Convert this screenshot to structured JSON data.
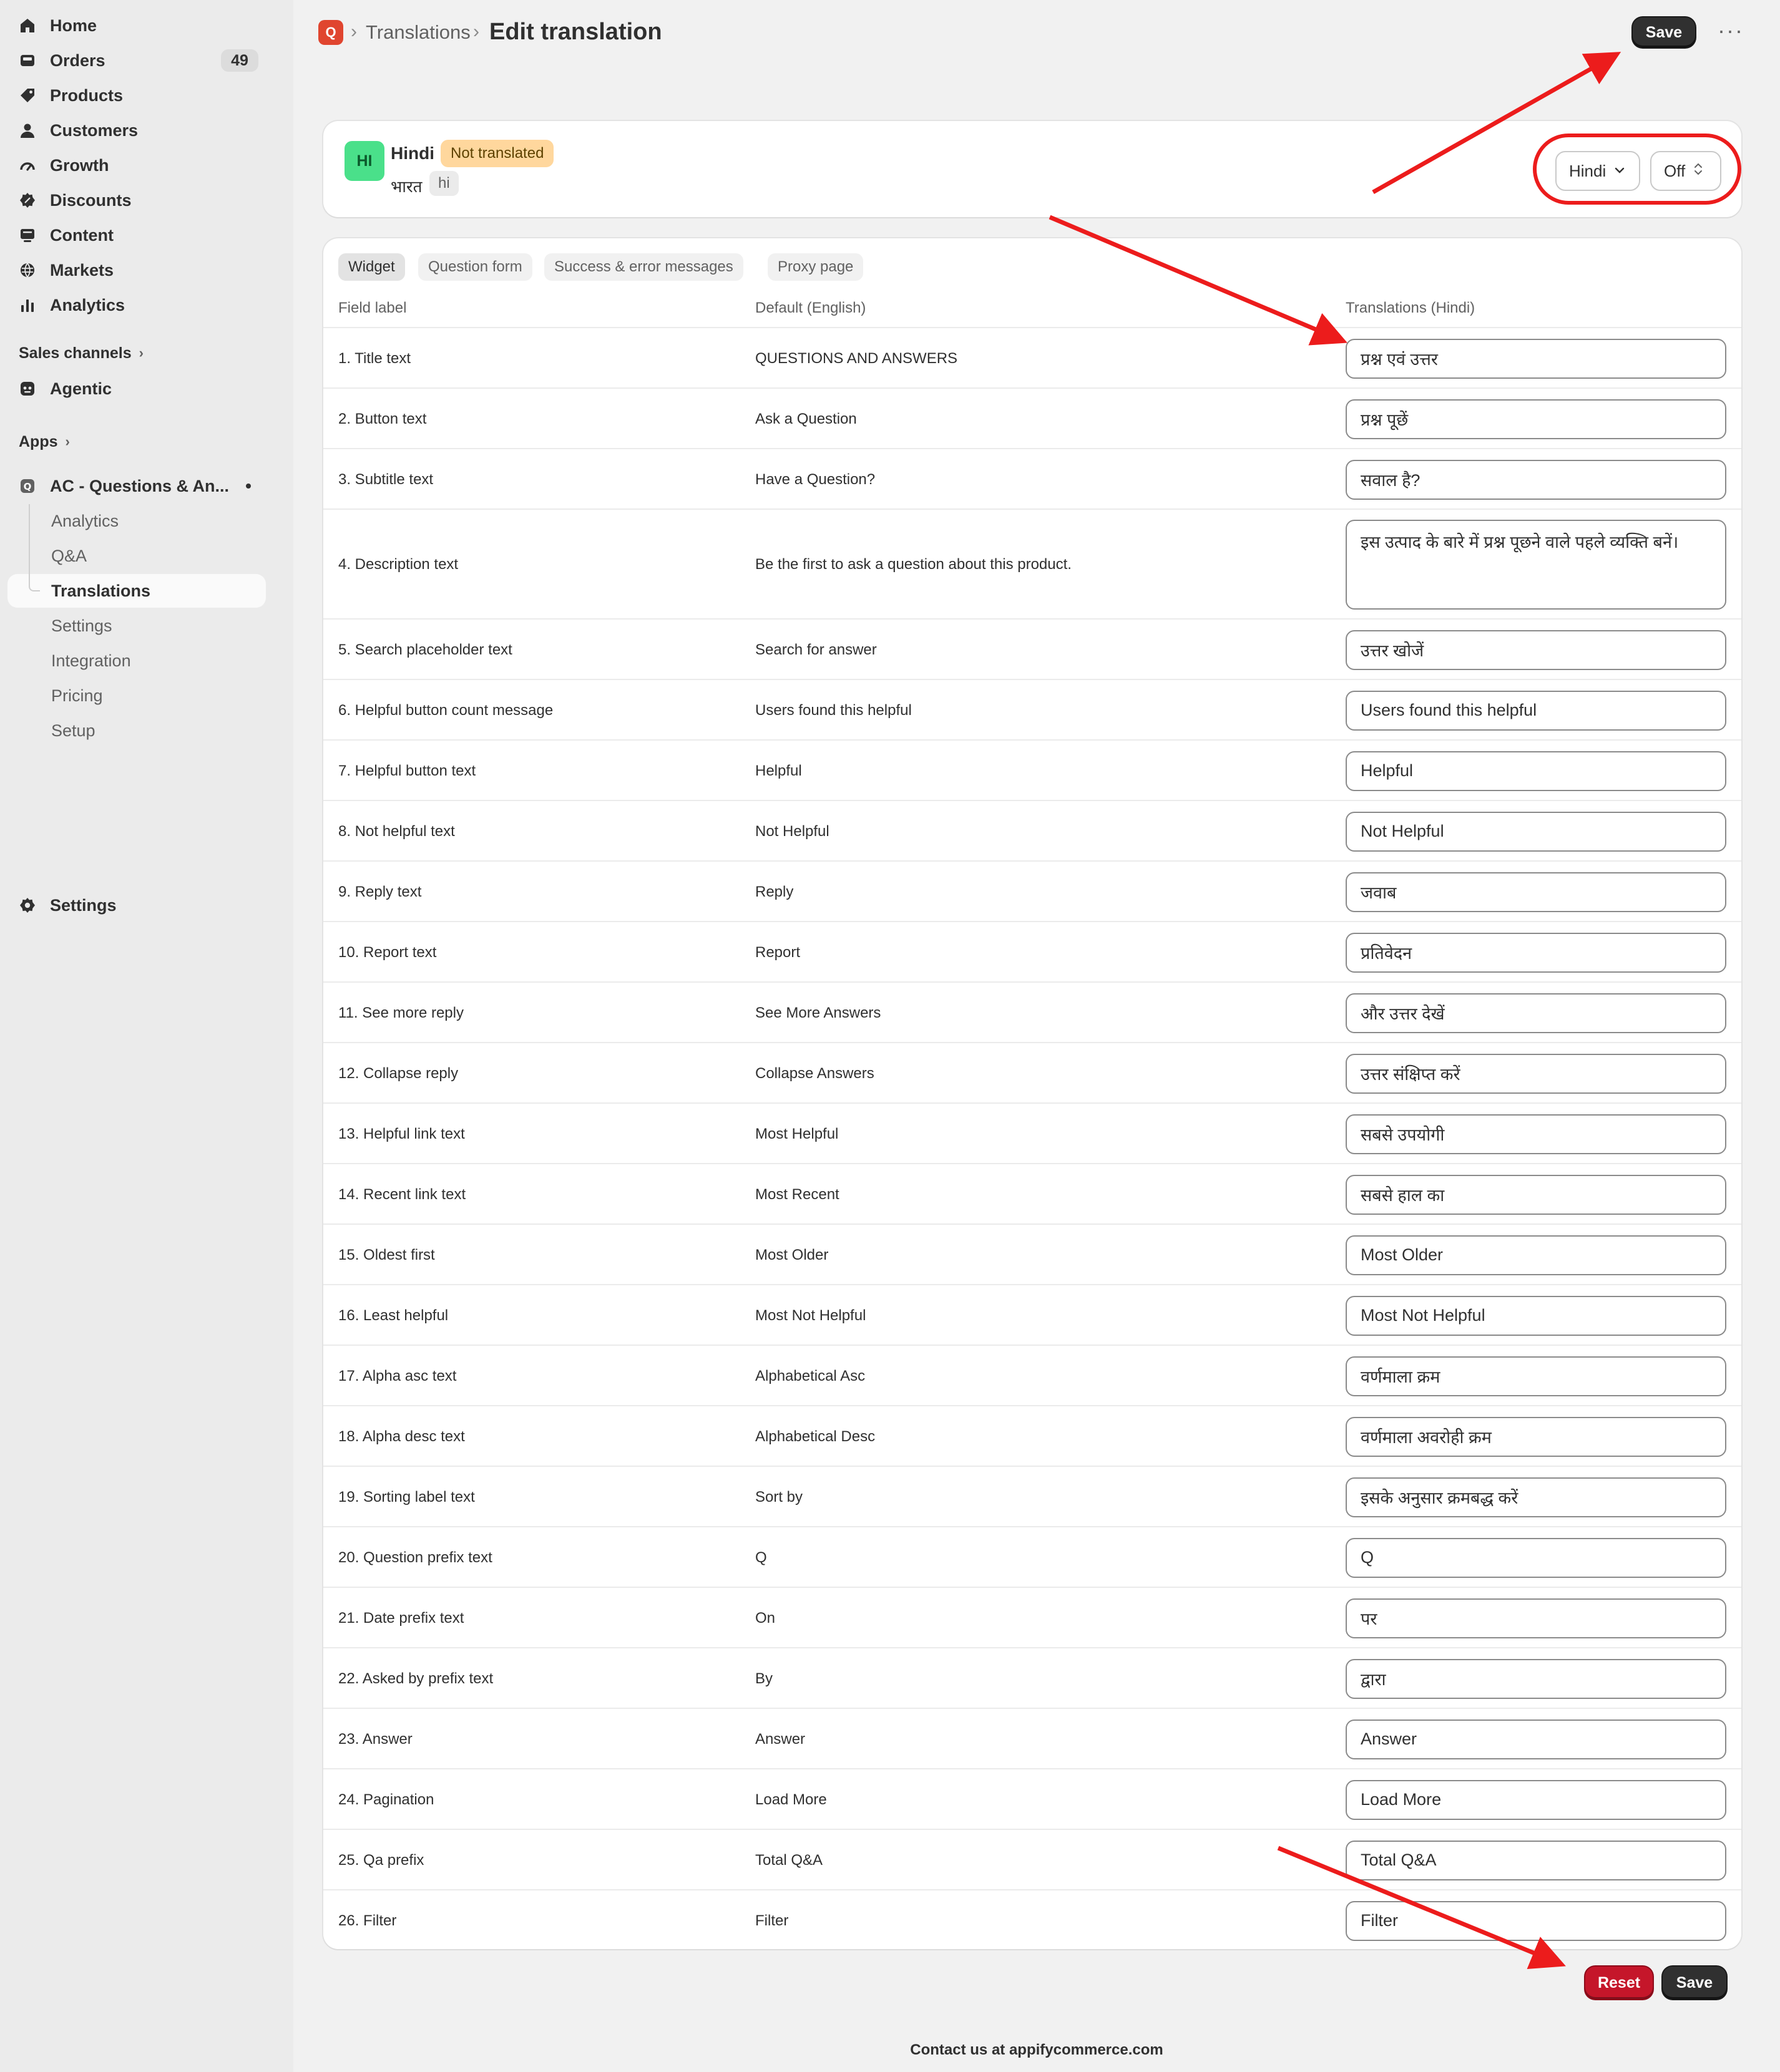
{
  "sidebar": {
    "items": [
      {
        "label": "Home",
        "icon": "home-icon"
      },
      {
        "label": "Orders",
        "icon": "orders-icon",
        "badge": "49"
      },
      {
        "label": "Products",
        "icon": "tag-icon"
      },
      {
        "label": "Customers",
        "icon": "person-icon"
      },
      {
        "label": "Growth",
        "icon": "gauge-icon"
      },
      {
        "label": "Discounts",
        "icon": "discount-icon"
      },
      {
        "label": "Content",
        "icon": "content-icon"
      },
      {
        "label": "Markets",
        "icon": "globe-icon"
      },
      {
        "label": "Analytics",
        "icon": "bar-chart-icon"
      }
    ],
    "sales_channels": "Sales channels",
    "agentic": "Agentic",
    "apps": "Apps",
    "app_name": "AC - Questions & An...",
    "app_subitems": [
      "Analytics",
      "Q&A",
      "Translations",
      "Settings",
      "Integration",
      "Pricing",
      "Setup"
    ],
    "settings": "Settings"
  },
  "header": {
    "app_logo": "Q",
    "breadcrumb": "Translations",
    "title": "Edit translation",
    "save": "Save"
  },
  "language": {
    "badge": "HI",
    "name": "Hindi",
    "status": "Not translated",
    "native": "भारत",
    "code": "hi",
    "select": "Hindi",
    "toggle": "Off"
  },
  "tabs": [
    "Widget",
    "Question form",
    "Success & error messages",
    "Proxy page"
  ],
  "table": {
    "headers": [
      "Field label",
      "Default (English)",
      "Translations (Hindi)"
    ],
    "rows": [
      {
        "label": "1. Title text",
        "default": "QUESTIONS AND ANSWERS",
        "translation": "प्रश्न एवं उत्तर"
      },
      {
        "label": "2. Button text",
        "default": "Ask a Question",
        "translation": "प्रश्न पूछें"
      },
      {
        "label": "3. Subtitle text",
        "default": "Have a Question?",
        "translation": "सवाल है?"
      },
      {
        "label": "4. Description text",
        "default": "Be the first to ask a question about this product.",
        "translation": "इस उत्पाद के बारे में प्रश्न पूछने वाले पहले व्यक्ति बनें।"
      },
      {
        "label": "5. Search placeholder text",
        "default": "Search for answer",
        "translation": "उत्तर खोजें"
      },
      {
        "label": "6. Helpful button count message",
        "default": "Users found this helpful",
        "translation": "Users found this helpful"
      },
      {
        "label": "7. Helpful button text",
        "default": "Helpful",
        "translation": "Helpful"
      },
      {
        "label": "8. Not helpful text",
        "default": "Not Helpful",
        "translation": "Not Helpful"
      },
      {
        "label": "9. Reply text",
        "default": "Reply",
        "translation": "जवाब"
      },
      {
        "label": "10. Report text",
        "default": "Report",
        "translation": "प्रतिवेदन"
      },
      {
        "label": "11. See more reply",
        "default": "See More Answers",
        "translation": "और उत्तर देखें"
      },
      {
        "label": "12. Collapse reply",
        "default": "Collapse Answers",
        "translation": "उत्तर संक्षिप्त करें"
      },
      {
        "label": "13. Helpful link text",
        "default": "Most Helpful",
        "translation": "सबसे उपयोगी"
      },
      {
        "label": "14. Recent link text",
        "default": "Most Recent",
        "translation": "सबसे हाल का"
      },
      {
        "label": "15. Oldest first",
        "default": "Most Older",
        "translation": "Most Older"
      },
      {
        "label": "16. Least helpful",
        "default": "Most Not Helpful",
        "translation": "Most Not Helpful"
      },
      {
        "label": "17. Alpha asc text",
        "default": "Alphabetical Asc",
        "translation": "वर्णमाला क्रम"
      },
      {
        "label": "18. Alpha desc text",
        "default": "Alphabetical Desc",
        "translation": "वर्णमाला अवरोही क्रम"
      },
      {
        "label": "19. Sorting label text",
        "default": "Sort by",
        "translation": "इसके अनुसार क्रमबद्ध करें"
      },
      {
        "label": "20. Question prefix text",
        "default": "Q",
        "translation": "Q"
      },
      {
        "label": "21. Date prefix text",
        "default": "On",
        "translation": "पर"
      },
      {
        "label": "22. Asked by prefix text",
        "default": "By",
        "translation": "द्वारा"
      },
      {
        "label": "23. Answer",
        "default": "Answer",
        "translation": "Answer"
      },
      {
        "label": "24. Pagination",
        "default": "Load More",
        "translation": "Load More"
      },
      {
        "label": "25. Qa prefix",
        "default": "Total Q&A",
        "translation": "Total Q&A"
      },
      {
        "label": "26. Filter",
        "default": "Filter",
        "translation": "Filter"
      }
    ]
  },
  "footer": {
    "reset": "Reset",
    "save": "Save",
    "contact": "Contact us at appifycommerce.com"
  },
  "colors": {
    "annotation": "#ec1c1c",
    "status_tag": "#ffd79d",
    "lang_badge": "#4ae08a",
    "reset_button": "#c5162a"
  }
}
